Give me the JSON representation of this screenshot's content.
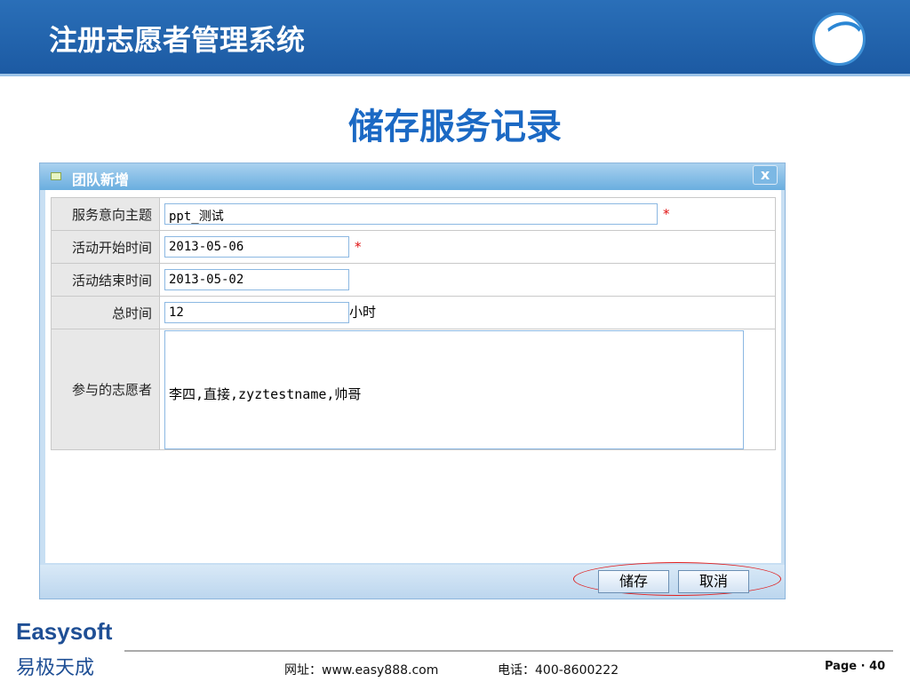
{
  "header": {
    "title": "注册志愿者管理系统"
  },
  "slide_title": "储存服务记录",
  "dialog": {
    "title": "团队新增",
    "close": "x",
    "fields": [
      {
        "label": "服务意向主题",
        "value": "ppt_测试",
        "required": "*"
      },
      {
        "label": "活动开始时间",
        "value": "2013-05-06",
        "required": "*"
      },
      {
        "label": "活动结束时间",
        "value": "2013-05-02"
      },
      {
        "label": "总时间",
        "value": "12",
        "unit": "小时"
      },
      {
        "label": "参与的志愿者",
        "value": "李四,直接,zyztestname,帅哥"
      }
    ],
    "save": "储存",
    "cancel": "取消"
  },
  "footer": {
    "brand": "Easysoft",
    "brand_cn": "易极天成",
    "url": "网址：www.easy888.com",
    "tel": "电话：400-8600222",
    "page": "Page · 40"
  }
}
